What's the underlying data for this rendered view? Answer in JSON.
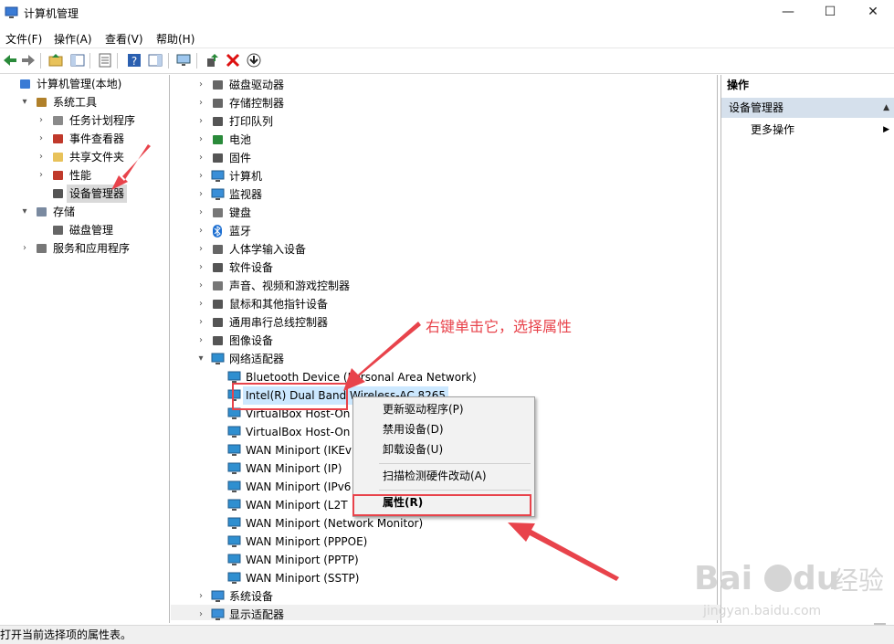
{
  "window": {
    "title": "计算机管理",
    "minimize": "—",
    "maximize": "☐",
    "close": "✕"
  },
  "menu": [
    "文件(F)",
    "操作(A)",
    "查看(V)",
    "帮助(H)"
  ],
  "toolbar": [
    "back-arrow-icon",
    "forward-arrow-icon",
    "folder-up-icon",
    "console-tree-icon",
    "export-list-icon",
    "help-icon",
    "show-hide-action-pane-icon",
    "monitor-icon",
    "update-driver-icon",
    "uninstall-x-icon",
    "download-icon"
  ],
  "left_tree": [
    {
      "label": "计算机管理(本地)",
      "indent": 0,
      "arrow": "",
      "icon": "computer-management-icon"
    },
    {
      "label": "系统工具",
      "indent": 1,
      "arrow": "▾",
      "icon": "tools-icon"
    },
    {
      "label": "任务计划程序",
      "indent": 2,
      "arrow": "›",
      "icon": "clock-icon"
    },
    {
      "label": "事件查看器",
      "indent": 2,
      "arrow": "›",
      "icon": "event-viewer-icon"
    },
    {
      "label": "共享文件夹",
      "indent": 2,
      "arrow": "›",
      "icon": "shared-folder-icon"
    },
    {
      "label": "性能",
      "indent": 2,
      "arrow": "›",
      "icon": "performance-icon"
    },
    {
      "label": "设备管理器",
      "indent": 2,
      "arrow": "",
      "icon": "device-manager-icon",
      "selected": true
    },
    {
      "label": "存储",
      "indent": 1,
      "arrow": "▾",
      "icon": "storage-icon"
    },
    {
      "label": "磁盘管理",
      "indent": 2,
      "arrow": "",
      "icon": "disk-management-icon"
    },
    {
      "label": "服务和应用程序",
      "indent": 1,
      "arrow": "›",
      "icon": "services-icon"
    }
  ],
  "device_tree": [
    {
      "label": "磁盘驱动器",
      "icon": "disk-drive-icon",
      "arrow": "›",
      "indent": 0
    },
    {
      "label": "存储控制器",
      "icon": "storage-controller-icon",
      "arrow": "›",
      "indent": 0
    },
    {
      "label": "打印队列",
      "icon": "printer-icon",
      "arrow": "›",
      "indent": 0
    },
    {
      "label": "电池",
      "icon": "battery-icon",
      "arrow": "›",
      "indent": 0
    },
    {
      "label": "固件",
      "icon": "firmware-icon",
      "arrow": "›",
      "indent": 0
    },
    {
      "label": "计算机",
      "icon": "computer-icon",
      "arrow": "›",
      "indent": 0
    },
    {
      "label": "监视器",
      "icon": "monitor-icon",
      "arrow": "›",
      "indent": 0
    },
    {
      "label": "键盘",
      "icon": "keyboard-icon",
      "arrow": "›",
      "indent": 0
    },
    {
      "label": "蓝牙",
      "icon": "bluetooth-icon",
      "arrow": "›",
      "indent": 0
    },
    {
      "label": "人体学输入设备",
      "icon": "hid-icon",
      "arrow": "›",
      "indent": 0
    },
    {
      "label": "软件设备",
      "icon": "software-device-icon",
      "arrow": "›",
      "indent": 0
    },
    {
      "label": "声音、视频和游戏控制器",
      "icon": "sound-icon",
      "arrow": "›",
      "indent": 0
    },
    {
      "label": "鼠标和其他指针设备",
      "icon": "mouse-icon",
      "arrow": "›",
      "indent": 0
    },
    {
      "label": "通用串行总线控制器",
      "icon": "usb-icon",
      "arrow": "›",
      "indent": 0
    },
    {
      "label": "图像设备",
      "icon": "camera-icon",
      "arrow": "›",
      "indent": 0
    },
    {
      "label": "网络适配器",
      "icon": "network-adapter-icon",
      "arrow": "▾",
      "indent": 0
    },
    {
      "label": "Bluetooth Device (Personal Area Network)",
      "icon": "network-adapter-icon",
      "arrow": "",
      "indent": 1
    },
    {
      "label": "Intel(R) Dual Band Wireless-AC 8265",
      "icon": "network-adapter-icon",
      "arrow": "",
      "indent": 1,
      "selected": true
    },
    {
      "label": "VirtualBox Host-On",
      "icon": "network-adapter-icon",
      "arrow": "",
      "indent": 1
    },
    {
      "label": "VirtualBox Host-On",
      "icon": "network-adapter-icon",
      "arrow": "",
      "indent": 1
    },
    {
      "label": "WAN Miniport (IKEv",
      "icon": "network-adapter-icon",
      "arrow": "",
      "indent": 1
    },
    {
      "label": "WAN Miniport (IP)",
      "icon": "network-adapter-icon",
      "arrow": "",
      "indent": 1
    },
    {
      "label": "WAN Miniport (IPv6",
      "icon": "network-adapter-icon",
      "arrow": "",
      "indent": 1
    },
    {
      "label": "WAN Miniport (L2T",
      "icon": "network-adapter-icon",
      "arrow": "",
      "indent": 1
    },
    {
      "label": "WAN Miniport (Network Monitor)",
      "icon": "network-adapter-icon",
      "arrow": "",
      "indent": 1
    },
    {
      "label": "WAN Miniport (PPPOE)",
      "icon": "network-adapter-icon",
      "arrow": "",
      "indent": 1
    },
    {
      "label": "WAN Miniport (PPTP)",
      "icon": "network-adapter-icon",
      "arrow": "",
      "indent": 1
    },
    {
      "label": "WAN Miniport (SSTP)",
      "icon": "network-adapter-icon",
      "arrow": "",
      "indent": 1
    },
    {
      "label": "系统设备",
      "icon": "system-device-icon",
      "arrow": "›",
      "indent": 0
    },
    {
      "label": "显示适配器",
      "icon": "display-adapter-icon",
      "arrow": "›",
      "indent": 0
    }
  ],
  "context_menu": {
    "update_driver": "更新驱动程序(P)",
    "disable_device": "禁用设备(D)",
    "uninstall_device": "卸载设备(U)",
    "scan_hardware": "扫描检测硬件改动(A)",
    "properties": "属性(R)"
  },
  "actions": {
    "header": "操作",
    "section": "设备管理器",
    "more": "更多操作"
  },
  "annotation": "右键单击它，选择属性",
  "status": "打开当前选择项的属性表。",
  "watermark": {
    "brand": "Bai du 经验",
    "url": "jingyan.baidu.com"
  },
  "colors": {
    "annotation_red": "#e8434b",
    "selection": "#cce8ff",
    "section_bg": "#d5e0ec"
  }
}
